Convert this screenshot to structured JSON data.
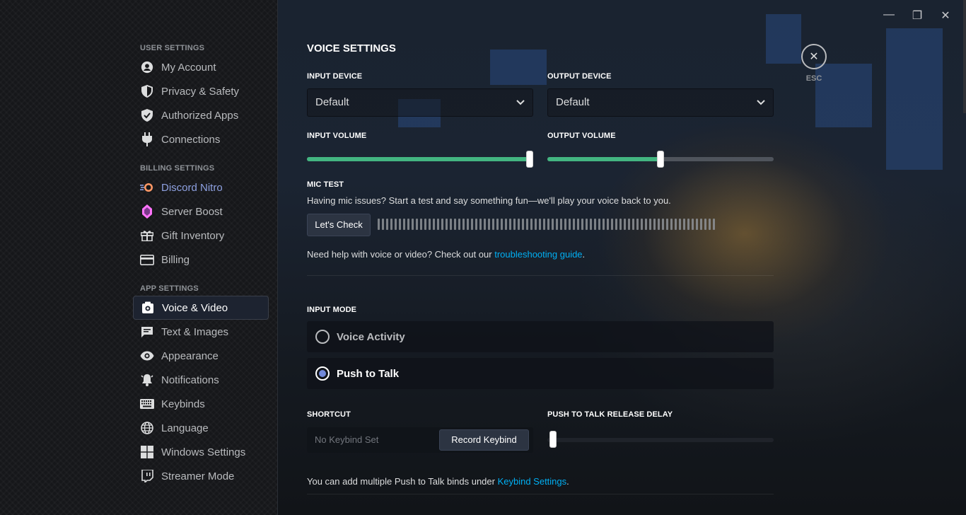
{
  "sidebar": {
    "user_settings": "USER SETTINGS",
    "user_items": [
      {
        "label": "My Account",
        "icon": "user-icon"
      },
      {
        "label": "Privacy & Safety",
        "icon": "shield-icon"
      },
      {
        "label": "Authorized Apps",
        "icon": "shield-check-icon"
      },
      {
        "label": "Connections",
        "icon": "plug-icon"
      }
    ],
    "billing_settings": "BILLING SETTINGS",
    "billing_items": [
      {
        "label": "Discord Nitro",
        "icon": "nitro-icon"
      },
      {
        "label": "Server Boost",
        "icon": "boost-gem-icon"
      },
      {
        "label": "Gift Inventory",
        "icon": "gift-icon"
      },
      {
        "label": "Billing",
        "icon": "credit-card-icon"
      }
    ],
    "app_settings": "APP SETTINGS",
    "app_items": [
      {
        "label": "Voice & Video",
        "icon": "voice-icon",
        "active": true
      },
      {
        "label": "Text & Images",
        "icon": "chat-icon"
      },
      {
        "label": "Appearance",
        "icon": "eye-icon"
      },
      {
        "label": "Notifications",
        "icon": "bell-icon"
      },
      {
        "label": "Keybinds",
        "icon": "keyboard-icon"
      },
      {
        "label": "Language",
        "icon": "globe-icon"
      },
      {
        "label": "Windows Settings",
        "icon": "windows-icon"
      },
      {
        "label": "Streamer Mode",
        "icon": "stream-icon"
      }
    ]
  },
  "window": {
    "minimize": "—",
    "maximize": "❐",
    "close": "✕"
  },
  "esc": {
    "label": "ESC",
    "glyph": "✕"
  },
  "voice": {
    "title": "VOICE SETTINGS",
    "input_device_label": "INPUT DEVICE",
    "input_device_value": "Default",
    "output_device_label": "OUTPUT DEVICE",
    "output_device_value": "Default",
    "input_volume_label": "INPUT VOLUME",
    "input_volume": 1.0,
    "output_volume_label": "OUTPUT VOLUME",
    "output_volume": 0.5,
    "mic_test_label": "MIC TEST",
    "mic_test_desc": "Having mic issues? Start a test and say something fun—we'll play your voice back to you.",
    "lets_check": "Let's Check",
    "help_text": "Need help with voice or video? Check out our ",
    "help_link": "troubleshooting guide",
    "help_suffix": ".",
    "input_mode_label": "INPUT MODE",
    "mode_voice_activity": "Voice Activity",
    "mode_push_to_talk": "Push to Talk",
    "selected_mode": "Push to Talk",
    "shortcut_label": "SHORTCUT",
    "shortcut_placeholder": "No Keybind Set",
    "record_keybind": "Record Keybind",
    "ptt_delay_label": "PUSH TO TALK RELEASE DELAY",
    "ptt_delay": 0.0,
    "ptt_note": "You can add multiple Push to Talk binds under ",
    "ptt_link": "Keybind Settings",
    "ptt_suffix": "."
  },
  "colors": {
    "accent": "#7289da",
    "slider": "#43b581",
    "link": "#00b0f4",
    "nitro": "#8ea1e1"
  }
}
